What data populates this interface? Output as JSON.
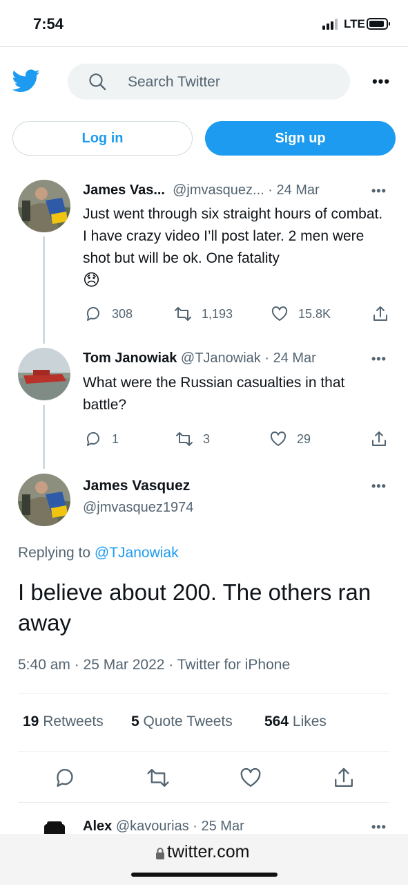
{
  "status_bar": {
    "time": "7:54",
    "network": "LTE"
  },
  "header": {
    "search_placeholder": "Search Twitter",
    "login_label": "Log in",
    "signup_label": "Sign up"
  },
  "colors": {
    "brand": "#1d9bf0",
    "secondary_text": "#536471",
    "primary_text": "#0f1419"
  },
  "tweets": [
    {
      "name": "James Vas...",
      "handle": "@jmvasquez...",
      "date": "· 24 Mar",
      "text": "Just went through six straight hours of combat. I have crazy video I’ll post later. 2 men were shot but will be ok. One fatality",
      "emoji": "😞",
      "replies": "308",
      "retweets": "1,193",
      "likes": "15.8K"
    },
    {
      "name": "Tom Janowiak",
      "handle": "@TJanowiak",
      "date": "· 24 Mar",
      "text": "What were the Russian casualties in that battle?",
      "replies": "1",
      "retweets": "3",
      "likes": "29"
    }
  ],
  "main_tweet": {
    "name": "James Vasquez",
    "handle": "@jmvasquez1974",
    "replying_prefix": "Replying to",
    "replying_to": "@TJanowiak",
    "text": "I believe about 200. The others ran away",
    "meta": "5:40 am · 25 Mar 2022 · Twitter for iPhone",
    "stats": {
      "retweets_count": "19",
      "retweets_label": "Retweets",
      "quotes_count": "5",
      "quotes_label": "Quote Tweets",
      "likes_count": "564",
      "likes_label": "Likes"
    }
  },
  "next_reply": {
    "name": "Alex",
    "handle": "@kavourias",
    "date": "· 25 Mar"
  },
  "browser": {
    "url": "twitter.com"
  },
  "icons": [
    "twitter-bird-icon",
    "search-icon",
    "more-icon",
    "reply-icon",
    "retweet-icon",
    "like-icon",
    "share-icon",
    "lock-icon"
  ]
}
